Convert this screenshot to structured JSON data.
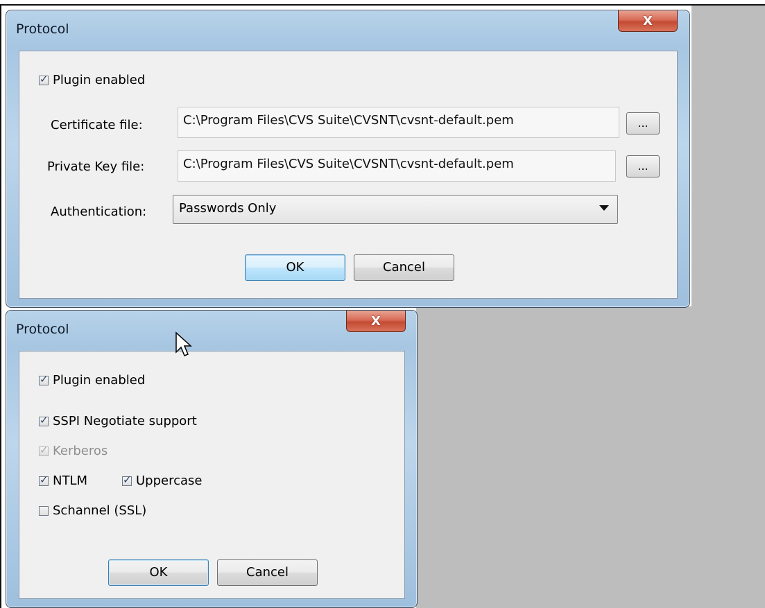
{
  "dialog_top": {
    "title": "Protocol",
    "close_label": "X",
    "plugin_enabled": {
      "label": "Plugin enabled",
      "checked": true
    },
    "certificate": {
      "label": "Certificate file:",
      "value": "C:\\Program Files\\CVS Suite\\CVSNT\\cvsnt-default.pem",
      "browse_label": "..."
    },
    "private_key": {
      "label": "Private Key file:",
      "value": "C:\\Program Files\\CVS Suite\\CVSNT\\cvsnt-default.pem",
      "browse_label": "..."
    },
    "authentication": {
      "label": "Authentication:",
      "selected": "Passwords Only"
    },
    "ok_label": "OK",
    "cancel_label": "Cancel"
  },
  "dialog_bottom": {
    "title": "Protocol",
    "close_label": "X",
    "plugin_enabled": {
      "label": "Plugin enabled",
      "checked": true
    },
    "sspi": {
      "label": "SSPI Negotiate support",
      "checked": true
    },
    "kerberos": {
      "label": "Kerberos",
      "checked": true,
      "disabled": true
    },
    "ntlm": {
      "label": "NTLM",
      "checked": true
    },
    "uppercase": {
      "label": "Uppercase",
      "checked": true
    },
    "schannel": {
      "label": "Schannel (SSL)",
      "checked": false
    },
    "ok_label": "OK",
    "cancel_label": "Cancel"
  }
}
